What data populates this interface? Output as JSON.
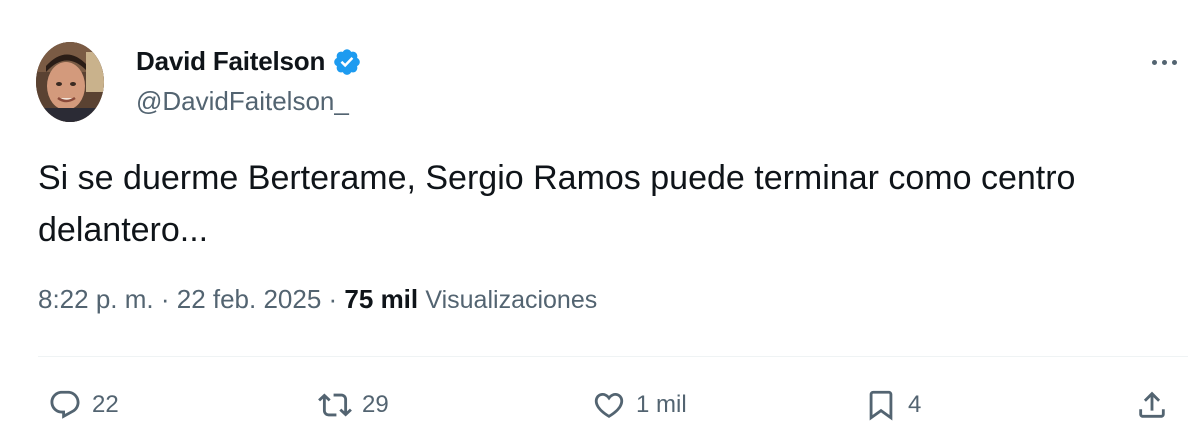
{
  "author": {
    "display_name": "David Faitelson",
    "handle": "@DavidFaitelson_",
    "verified": true
  },
  "tweet": {
    "text": "Si se duerme Berterame, Sergio Ramos puede terminar como centro\ndelantero...",
    "time": "8:22 p. m.",
    "separator": " · ",
    "date": "22 feb. 2025",
    "views_count": "75 mil",
    "views_label": "Visualizaciones"
  },
  "actions": {
    "replies": "22",
    "reposts": "29",
    "likes": "1 mil",
    "bookmarks": "4"
  },
  "colors": {
    "text_primary": "#0f1419",
    "text_secondary": "#536471",
    "verified_blue": "#1d9bf0",
    "divider": "#eff3f4"
  },
  "icons": {
    "reply": "reply-icon",
    "repost": "repost-icon",
    "like": "heart-icon",
    "bookmark": "bookmark-icon",
    "share": "share-icon",
    "more": "more-icon",
    "verified": "verified-badge-icon"
  }
}
